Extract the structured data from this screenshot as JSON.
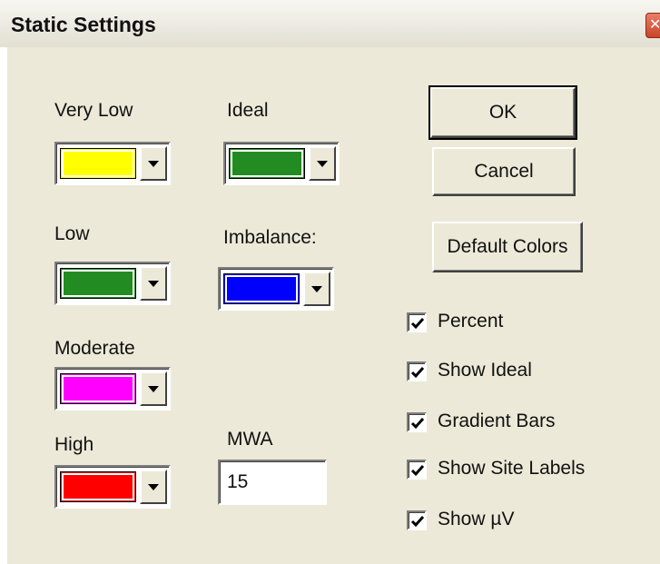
{
  "window": {
    "title": "Static Settings",
    "close_icon": "close-icon"
  },
  "colors": {
    "very_low": {
      "label": "Very Low",
      "color": "#ffff00"
    },
    "ideal": {
      "label": "Ideal",
      "color": "#228b22"
    },
    "low": {
      "label": "Low",
      "color": "#228b22"
    },
    "imbalance": {
      "label": "Imbalance:",
      "color": "#0000ff"
    },
    "moderate": {
      "label": "Moderate",
      "color": "#ff00ff"
    },
    "high": {
      "label": "High",
      "color": "#ff0000"
    }
  },
  "mwa": {
    "label": "MWA",
    "value": "15"
  },
  "buttons": {
    "ok": "OK",
    "cancel": "Cancel",
    "default_colors": "Default Colors"
  },
  "checkboxes": [
    {
      "label": "Percent",
      "checked": true
    },
    {
      "label": "Show Ideal",
      "checked": true
    },
    {
      "label": "Gradient Bars",
      "checked": true
    },
    {
      "label": "Show Site Labels",
      "checked": true
    },
    {
      "label": "Show µV",
      "checked": true
    }
  ]
}
